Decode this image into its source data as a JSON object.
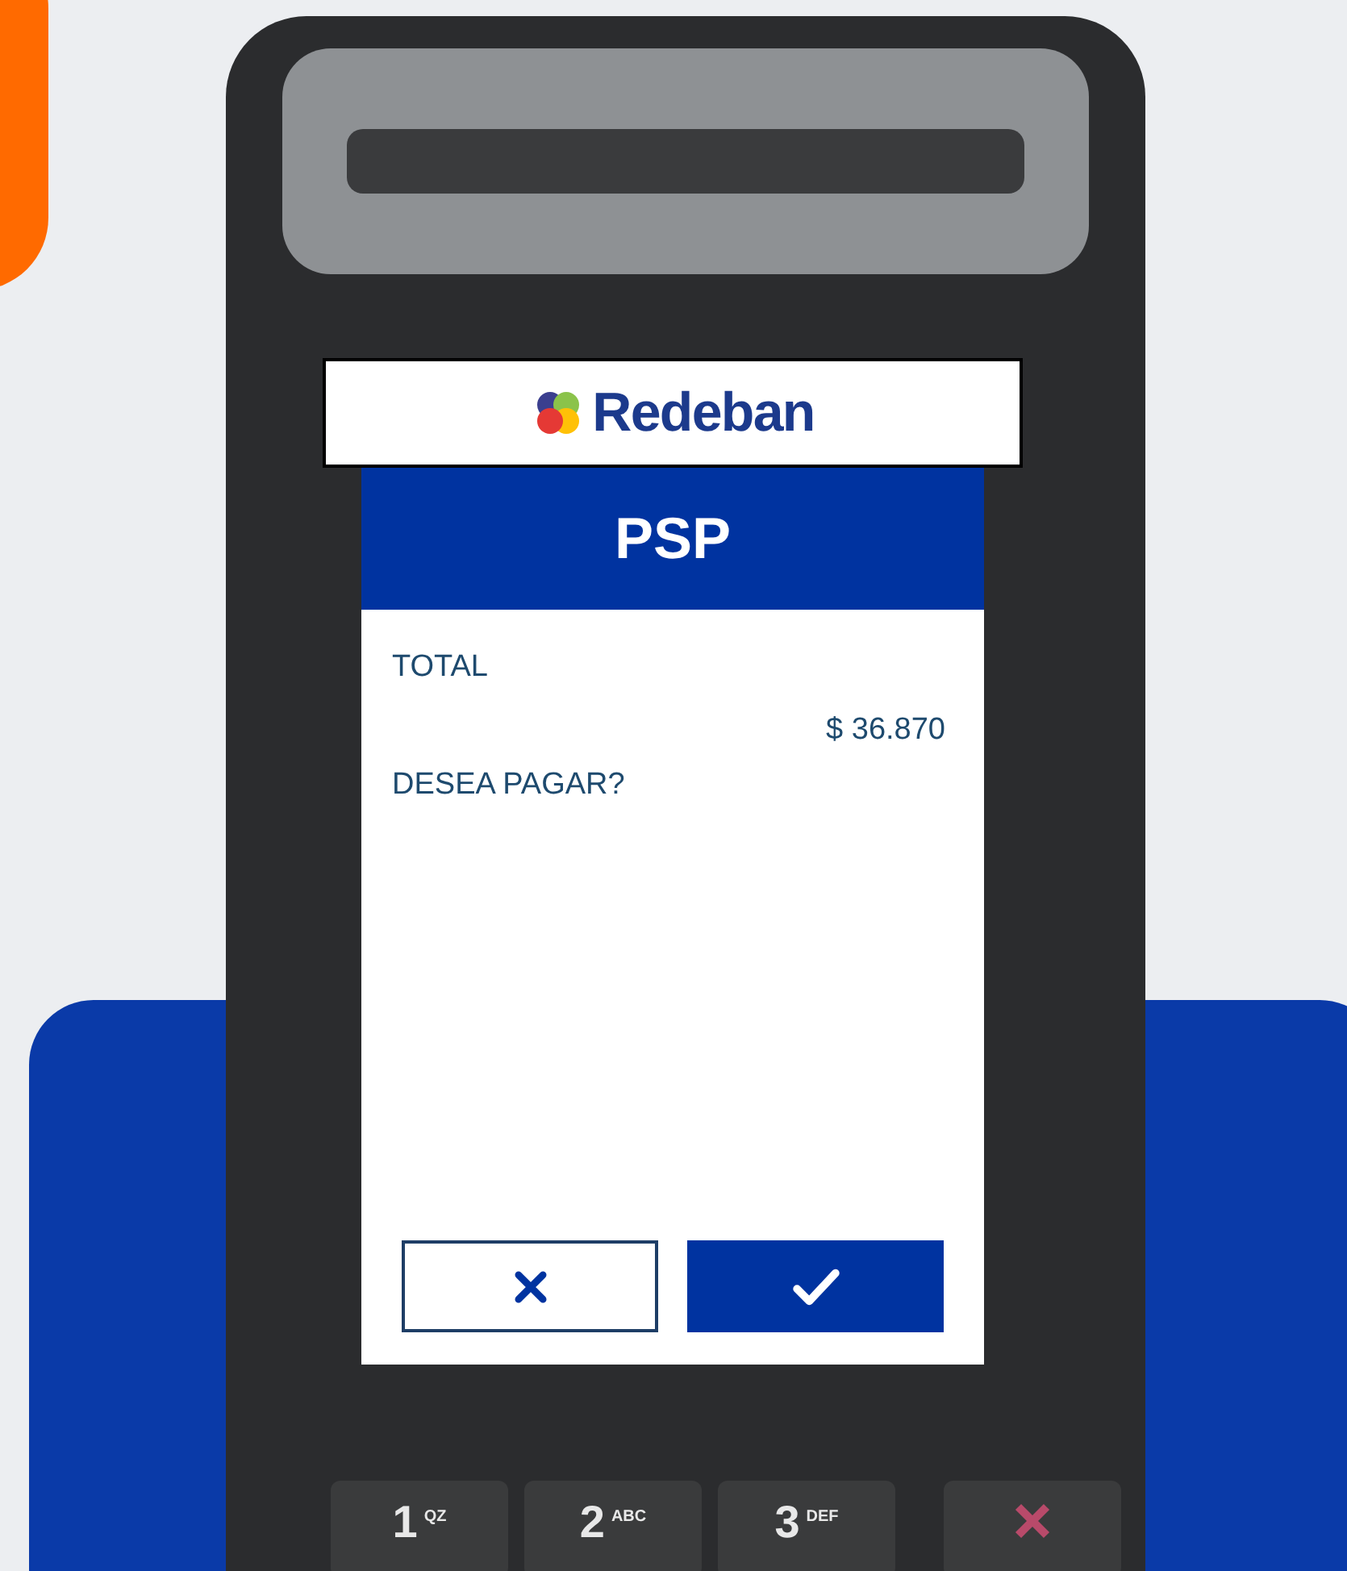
{
  "logo": {
    "text": "Redeban"
  },
  "screen": {
    "title": "PSP",
    "label": "TOTAL",
    "amount": "$ 36.870",
    "prompt": "DESEA PAGAR?"
  },
  "buttons": [
    {
      "kind": "cancel"
    },
    {
      "kind": "confirm"
    }
  ],
  "keypad": [
    {
      "digit": "1",
      "letters": "QZ"
    },
    {
      "digit": "2",
      "letters": "ABC"
    },
    {
      "digit": "3",
      "letters": "DEF"
    },
    {
      "kind": "cancel"
    }
  ]
}
